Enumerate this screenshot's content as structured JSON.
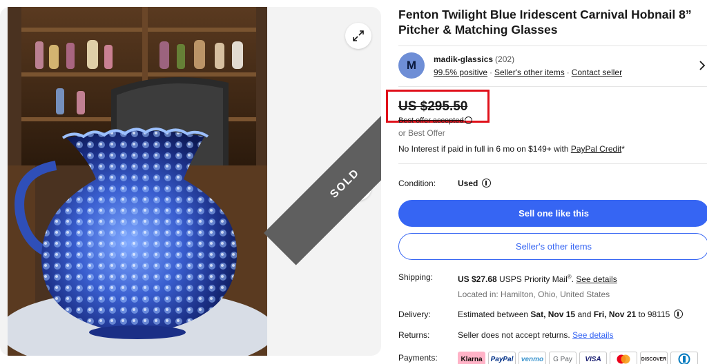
{
  "listing": {
    "title": "Fenton Twilight Blue Iridescent Carnival Hobnail 8” Pitcher & Matching Glasses",
    "sold_badge": "SOLD"
  },
  "seller": {
    "avatar_letter": "M",
    "name": "madik-glassics",
    "feedback_count": "(202)",
    "positive": "99.5% positive",
    "other_items_link": "Seller's other items",
    "contact_link": "Contact seller",
    "separator": "·"
  },
  "price": {
    "amount": "US $295.50",
    "best_offer_accepted": "Best offer accepted",
    "or_best_offer": "or Best Offer",
    "financing_text": "No Interest if paid in full in 6 mo on $149+ with ",
    "financing_link": "PayPal Credit",
    "financing_suffix": "*"
  },
  "details": {
    "condition_label": "Condition:",
    "condition_value": "Used",
    "shipping_label": "Shipping:",
    "shipping_price": "US $27.68",
    "shipping_method": " USPS Priority Mail",
    "shipping_reg": "®",
    "shipping_dot": ". ",
    "shipping_link": "See details",
    "location": "Located in: Hamilton, Ohio, United States",
    "delivery_label": "Delivery:",
    "delivery_prefix": "Estimated between ",
    "delivery_start": "Sat, Nov 15",
    "delivery_and": " and ",
    "delivery_end": "Fri, Nov 21",
    "delivery_suffix": " to 98115",
    "returns_label": "Returns:",
    "returns_text": "Seller does not accept returns. ",
    "returns_link": "See details",
    "payments_label": "Payments:"
  },
  "buttons": {
    "primary": "Sell one like this",
    "secondary": "Seller's other items"
  },
  "payment_methods": [
    "Klarna",
    "PayPal",
    "venmo",
    "G Pay",
    "VISA",
    "mastercard",
    "DISCOVER",
    "diners"
  ],
  "colors": {
    "accent": "#3665f3",
    "highlight_box": "#e0101a",
    "klarna": "#ffb3c7",
    "paypal": "#003087",
    "venmo": "#3d95ce",
    "visa": "#1a1f71"
  }
}
